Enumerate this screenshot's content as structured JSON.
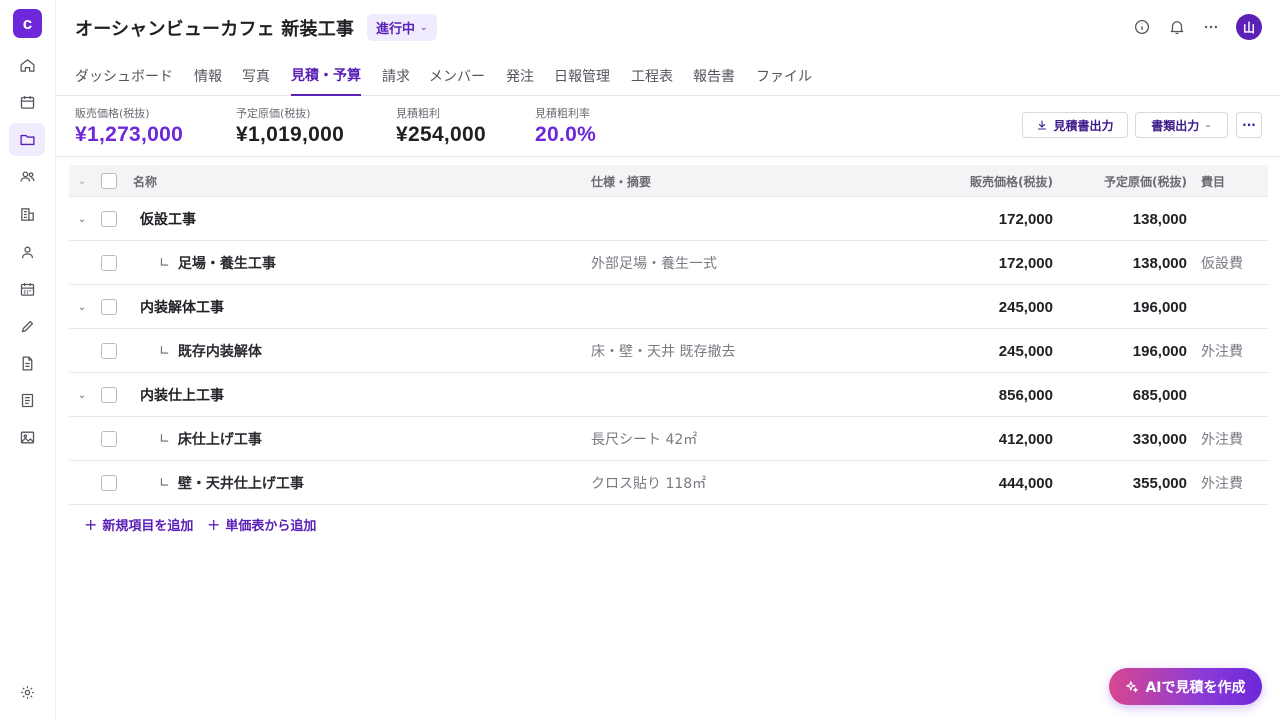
{
  "app": {
    "logo_letter": "c"
  },
  "sidebar": {
    "items": [
      {
        "icon": "home-icon"
      },
      {
        "icon": "calendar-icon"
      },
      {
        "icon": "folder-icon",
        "active": true
      },
      {
        "icon": "users-icon"
      },
      {
        "icon": "building-icon"
      },
      {
        "icon": "person-icon"
      },
      {
        "icon": "schedule-icon"
      },
      {
        "icon": "pencil-icon"
      },
      {
        "icon": "document-icon"
      },
      {
        "icon": "report-icon"
      },
      {
        "icon": "image-icon"
      }
    ],
    "settings_icon": "gear-icon"
  },
  "header": {
    "title": "オーシャンビューカフェ 新装工事",
    "status": "進行中",
    "user_initial": "山"
  },
  "tabs": [
    {
      "label": "ダッシュボード"
    },
    {
      "label": "情報"
    },
    {
      "label": "写真"
    },
    {
      "label": "見積・予算",
      "active": true
    },
    {
      "label": "請求"
    },
    {
      "label": "メンバー"
    },
    {
      "label": "発注"
    },
    {
      "label": "日報管理"
    },
    {
      "label": "工程表"
    },
    {
      "label": "報告書"
    },
    {
      "label": "ファイル"
    }
  ],
  "summary": {
    "metrics": [
      {
        "label": "販売価格(税抜)",
        "value": "¥1,273,000",
        "accent": true
      },
      {
        "label": "予定原価(税抜)",
        "value": "¥1,019,000"
      },
      {
        "label": "見積粗利",
        "value": "¥254,000"
      },
      {
        "label": "見積粗利率",
        "value": "20.0%",
        "accent": true
      }
    ],
    "export_estimate_label": "見積書出力",
    "export_docs_label": "書類出力",
    "more_label": "···"
  },
  "table": {
    "headers": {
      "name": "名称",
      "spec": "仕様・摘要",
      "sale_price": "販売価格(税抜)",
      "planned_cost": "予定原価(税抜)",
      "category": "費目"
    },
    "rows": [
      {
        "type": "parent",
        "name": "仮設工事",
        "spec": "",
        "sale": "172,000",
        "cost": "138,000",
        "category": ""
      },
      {
        "type": "child",
        "branch": "∟",
        "name": "足場・養生工事",
        "spec": "外部足場・養生一式",
        "sale": "172,000",
        "cost": "138,000",
        "category": "仮設費"
      },
      {
        "type": "parent",
        "name": "内装解体工事",
        "spec": "",
        "sale": "245,000",
        "cost": "196,000",
        "category": ""
      },
      {
        "type": "child",
        "branch": "∟",
        "name": "既存内装解体",
        "spec": "床・壁・天井 既存撤去",
        "sale": "245,000",
        "cost": "196,000",
        "category": "外注費"
      },
      {
        "type": "parent",
        "name": "内装仕上工事",
        "spec": "",
        "sale": "856,000",
        "cost": "685,000",
        "category": ""
      },
      {
        "type": "child",
        "branch": "∟",
        "name": "床仕上げ工事",
        "spec": "長尺シート 42㎡",
        "sale": "412,000",
        "cost": "330,000",
        "category": "外注費"
      },
      {
        "type": "child",
        "branch": "∟",
        "name": "壁・天井仕上げ工事",
        "spec": "クロス貼り 118㎡",
        "sale": "444,000",
        "cost": "355,000",
        "category": "外注費"
      }
    ]
  },
  "actions": {
    "add_item": "新規項目を追加",
    "add_from_price_list": "単価表から追加",
    "plus": "+"
  },
  "ai_button": {
    "label": "AIで見積を作成"
  },
  "colors": {
    "accent": "#6d28d9",
    "accent_dark": "#5b21b6",
    "accent_bg": "#f0ebfd"
  }
}
